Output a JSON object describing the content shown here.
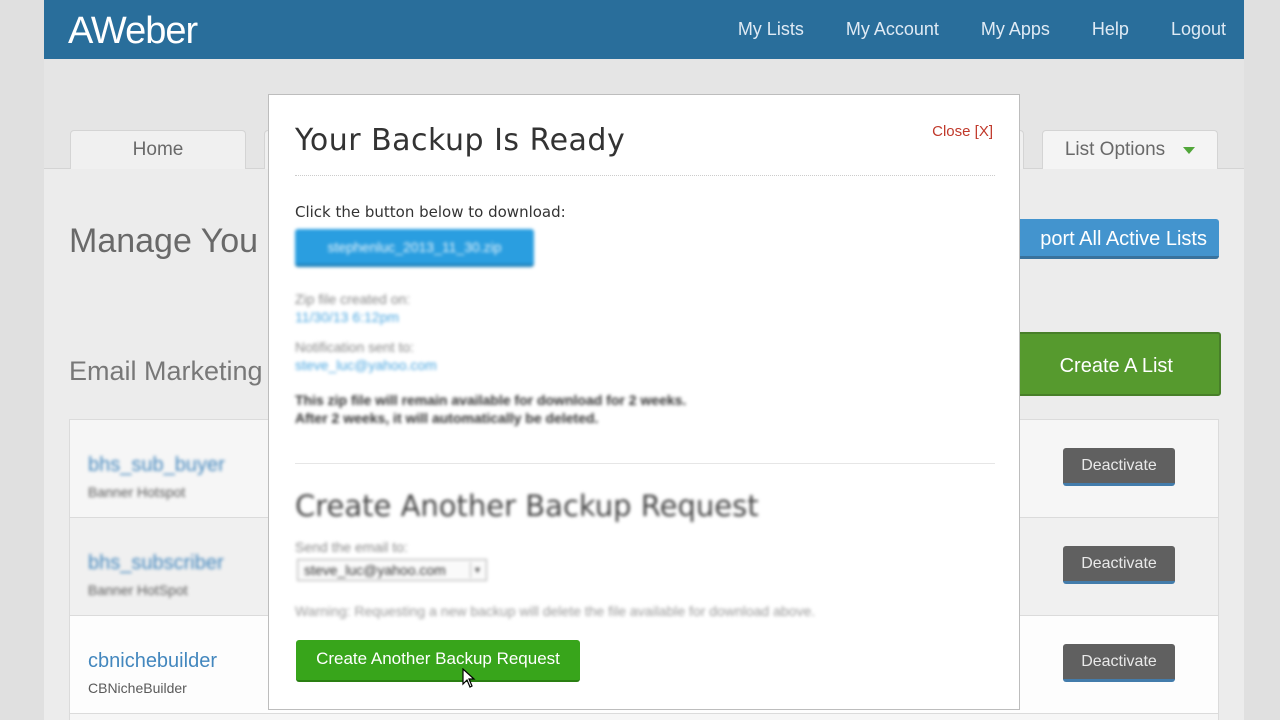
{
  "brand": {
    "logo": "AWeber"
  },
  "nav": {
    "items": [
      "My Lists",
      "My Account",
      "My Apps",
      "Help",
      "Logout"
    ]
  },
  "tabs": {
    "home": "Home",
    "list_options": "List Options"
  },
  "page": {
    "heading": "Manage You",
    "subheading": "Email Marketing",
    "export_button": "port All Active Lists",
    "create_list_button": "Create A List"
  },
  "lists": [
    {
      "name": "bhs_sub_buyer",
      "company": "Banner Hotspot",
      "action": "Deactivate"
    },
    {
      "name": "bhs_subscriber",
      "company": "Banner HotSpot",
      "action": "Deactivate"
    },
    {
      "name": "cbnichebuilder",
      "company": "CBNicheBuilder",
      "action": "Deactivate"
    }
  ],
  "modal": {
    "title": "Your Backup Is Ready",
    "close_label": "Close [X]",
    "lead": "Click the button below to download:",
    "zip_button": "stephenluc_2013_11_30.zip",
    "created_label": "Zip file created on:",
    "created_value": "11/30/13 6:12pm",
    "notify_label": "Notification sent to:",
    "notify_value": "steve_luc@yahoo.com",
    "note_line1": "This zip file will remain available for download for 2 weeks.",
    "note_line2": "After 2 weeks, it will automatically be deleted.",
    "section_title": "Create Another Backup Request",
    "send_label": "Send the email to:",
    "send_select_value": "steve_luc@yahoo.com",
    "warning": "Warning: Requesting a new backup will delete the file available for download above.",
    "submit_button": "Create Another Backup Request"
  },
  "colors": {
    "topbar": "#0c5a8e",
    "accent_blue": "#2a86c8",
    "accent_green": "#38a51b",
    "close_red": "#c0392b"
  }
}
